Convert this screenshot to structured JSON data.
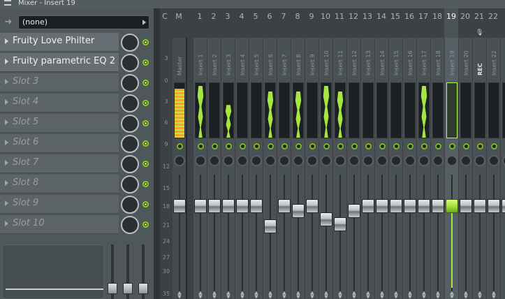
{
  "window": {
    "title": "Mixer - Insert 19"
  },
  "routing": {
    "value": "(none)"
  },
  "slots": [
    {
      "label": "Fruity Love Philter",
      "filled": true
    },
    {
      "label": "Fruity parametric EQ 2",
      "filled": true
    },
    {
      "label": "Slot 3",
      "filled": false
    },
    {
      "label": "Slot 4",
      "filled": false
    },
    {
      "label": "Slot 5",
      "filled": false
    },
    {
      "label": "Slot 6",
      "filled": false
    },
    {
      "label": "Slot 7",
      "filled": false
    },
    {
      "label": "Slot 8",
      "filled": false
    },
    {
      "label": "Slot 9",
      "filled": false
    },
    {
      "label": "Slot 10",
      "filled": false
    }
  ],
  "mixer": {
    "header_labels": [
      "C",
      "M",
      "1",
      "2",
      "3",
      "4",
      "5",
      "6",
      "7",
      "8",
      "9",
      "10",
      "11",
      "12",
      "13",
      "14",
      "15",
      "16",
      "17",
      "18",
      "19",
      "20",
      "21",
      "22",
      "2"
    ],
    "db_scale": [
      "3",
      "0",
      "3",
      "6",
      "9",
      "12",
      "15",
      "18",
      "21",
      "24",
      "27",
      "30",
      "35"
    ],
    "channels": [
      {
        "name": "Master",
        "level": 0.9,
        "fader": 0.78
      },
      {
        "name": "Insert 1",
        "level": 0.95,
        "fader": 0.78
      },
      {
        "name": "Insert 2",
        "level": 0.0,
        "fader": 0.78
      },
      {
        "name": "Insert 3",
        "level": 0.6,
        "fader": 0.78
      },
      {
        "name": "Insert 4",
        "level": 0.0,
        "fader": 0.78
      },
      {
        "name": "Insert 5",
        "level": 0.0,
        "fader": 0.78
      },
      {
        "name": "Insert 6",
        "level": 0.85,
        "fader": 0.6
      },
      {
        "name": "Insert 7",
        "level": 0.0,
        "fader": 0.78
      },
      {
        "name": "Insert 8",
        "level": 0.85,
        "fader": 0.74
      },
      {
        "name": "Insert 9",
        "level": 0.0,
        "fader": 0.78
      },
      {
        "name": "Insert 10",
        "level": 0.95,
        "fader": 0.66
      },
      {
        "name": "Insert 11",
        "level": 0.85,
        "fader": 0.62
      },
      {
        "name": "Insert 12",
        "level": 0.0,
        "fader": 0.74
      },
      {
        "name": "Insert 13",
        "level": 0.0,
        "fader": 0.78
      },
      {
        "name": "Insert 14",
        "level": 0.0,
        "fader": 0.78
      },
      {
        "name": "Insert 15",
        "level": 0.0,
        "fader": 0.78
      },
      {
        "name": "Insert 16",
        "level": 0.0,
        "fader": 0.78
      },
      {
        "name": "Insert 17",
        "level": 0.95,
        "fader": 0.78
      },
      {
        "name": "Insert 18",
        "level": 0.0,
        "fader": 0.78
      },
      {
        "name": "Insert 19",
        "level": 0.0,
        "fader": 0.78,
        "selected": true
      },
      {
        "name": "Insert 20",
        "level": 0.0,
        "fader": 0.78
      },
      {
        "name": "REC",
        "level": 0.0,
        "fader": 0.78
      },
      {
        "name": "Insert 22",
        "level": 0.0,
        "fader": 0.78
      },
      {
        "name": "Insert",
        "level": 0.0,
        "fader": 0.78
      }
    ]
  },
  "colors": {
    "accent": "#a6e640",
    "meter_high": "#f5a52a",
    "background": "#3d4347"
  }
}
